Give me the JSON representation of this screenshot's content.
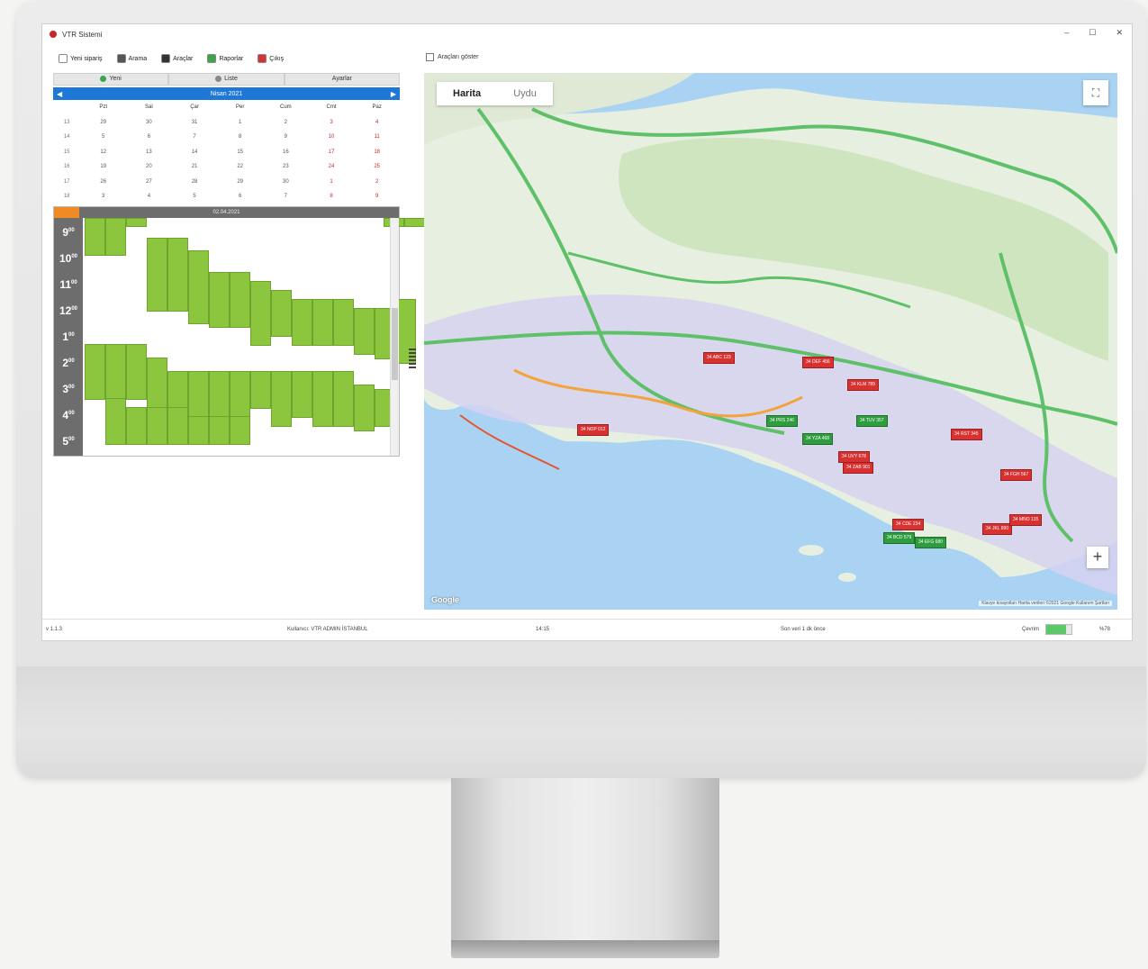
{
  "window": {
    "title": "VTR Sistemi",
    "minimize": "–",
    "maximize": "☐",
    "close": "✕"
  },
  "toolbar": [
    {
      "name": "new-order-button",
      "label": "Yeni sipariş",
      "color": "#ffffff"
    },
    {
      "name": "search-button",
      "label": "Arama",
      "color": "#555555"
    },
    {
      "name": "vehicles-button",
      "label": "Araçlar",
      "color": "#333333"
    },
    {
      "name": "reports-button",
      "label": "Raporlar",
      "color": "#3aa54a"
    },
    {
      "name": "exit-button",
      "label": "Çıkış",
      "color": "#d93030"
    }
  ],
  "left_tabs": [
    {
      "name": "tab-new",
      "label": "Yeni",
      "icon_color": "#3aa54a"
    },
    {
      "name": "tab-list",
      "label": "Liste",
      "icon_color": "#888888"
    },
    {
      "name": "tab-settings",
      "label": "Ayarlar",
      "icon_color": ""
    }
  ],
  "calendar": {
    "month_label": "Nisan 2021",
    "weekdays": [
      "",
      "Pzt",
      "Sal",
      "Çar",
      "Per",
      "Cum",
      "Cmt",
      "Paz"
    ],
    "weeks": [
      [
        "13",
        "29",
        "30",
        "31",
        "1",
        "2",
        "3",
        "4"
      ],
      [
        "14",
        "5",
        "6",
        "7",
        "8",
        "9",
        "10",
        "11"
      ],
      [
        "15",
        "12",
        "13",
        "14",
        "15",
        "16",
        "17",
        "18"
      ],
      [
        "16",
        "19",
        "20",
        "21",
        "22",
        "23",
        "24",
        "25"
      ],
      [
        "17",
        "26",
        "27",
        "28",
        "29",
        "30",
        "1",
        "2"
      ],
      [
        "18",
        "3",
        "4",
        "5",
        "6",
        "7",
        "8",
        "9"
      ]
    ]
  },
  "schedule": {
    "date_label": "02.04.2021",
    "hours": [
      {
        "h": "9",
        "m": "00"
      },
      {
        "h": "10",
        "m": "00"
      },
      {
        "h": "11",
        "m": "00"
      },
      {
        "h": "12",
        "m": "00"
      },
      {
        "h": "1",
        "m": "00"
      },
      {
        "h": "2",
        "m": "00"
      },
      {
        "h": "3",
        "m": "00"
      },
      {
        "h": "4",
        "m": "00"
      },
      {
        "h": "5",
        "m": "00"
      }
    ]
  },
  "map_panel": {
    "checkbox_label": "Araçları göster",
    "tabs": [
      {
        "label": "Harita",
        "active": true
      },
      {
        "label": "Uydu",
        "active": false
      }
    ],
    "fullscreen_icon": "⛶",
    "zoom_in": "+",
    "attribution": "Klavye kısayolları   Harita verileri ©2021 Google   Kullanım Şartları",
    "google_logo": "Google"
  },
  "map_markers": {
    "red": [
      "34 ABC 123",
      "34 DEF 456",
      "34 KLM 789",
      "34 NOP 012",
      "34 RST 345",
      "34 UVY 678",
      "34 ZAB 901",
      "34 CDE 234",
      "34 FGH 567",
      "34 JKL 890",
      "34 MNO 135"
    ],
    "green": [
      "34 PRS 246",
      "34 TUV 357",
      "34 YZA 468",
      "34 BCD 579",
      "34 EFG 680"
    ]
  },
  "statusbar": {
    "version": "v 1.1.3",
    "user": "Kullanıcı: VTR ADMIN İSTANBUL",
    "time": "14:15",
    "connection": "Son veri 1 dk önce",
    "online_label": "Çevrim",
    "progress_pct": 78,
    "progress_text": "%78"
  },
  "colors": {
    "calendar_header": "#1e78d7",
    "schedule_block": "#8cc63f",
    "marker_red": "#d93030",
    "marker_green": "#2e9d3e"
  }
}
